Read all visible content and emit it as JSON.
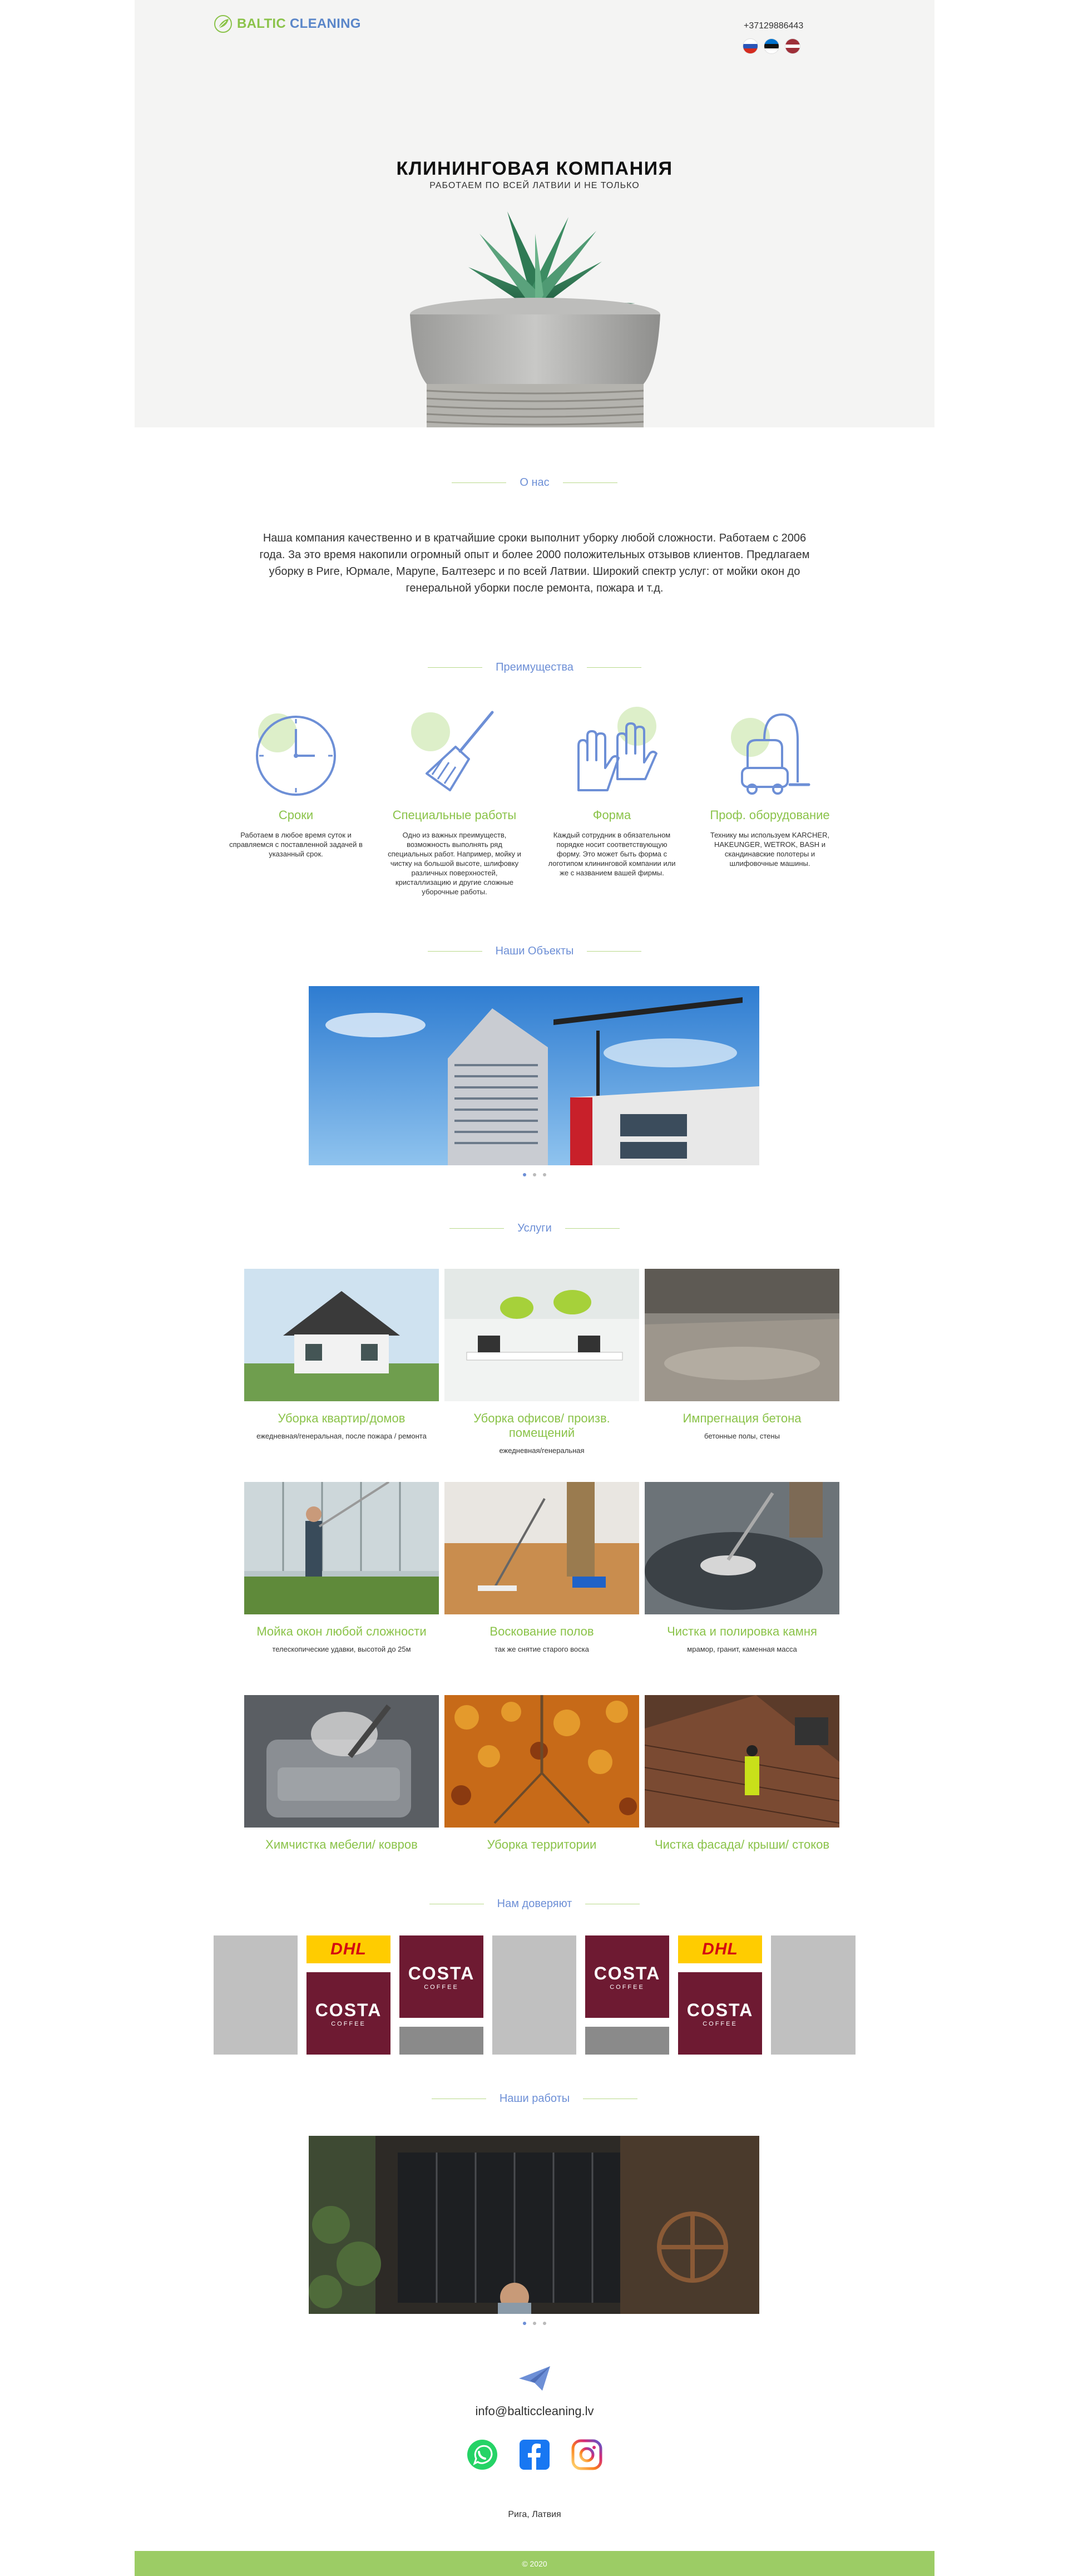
{
  "header": {
    "logo_part1": "BALTIC",
    "logo_part2": "CLEANING",
    "phone": "+37129886443",
    "languages": [
      "ru",
      "ee",
      "lv"
    ]
  },
  "hero": {
    "title": "КЛИНИНГОВАЯ КОМПАНИЯ",
    "subtitle": "РАБОТАЕМ ПО ВСЕЙ ЛАТВИИ И НЕ ТОЛЬКО"
  },
  "about": {
    "title": "О нас",
    "text": "Наша компания качественно и в кратчайшие сроки выполнит уборку любой сложности. Работаем с 2006 года. За это время накопили огромный опыт и более 2000 положительных отзывов клиентов. Предлагаем уборку в Риге, Юрмале, Марупе, Балтезерс и по всей Латвии. Широкий спектр услуг: от мойки окон до генеральной уборки после ремонта, пожара и т.д."
  },
  "advantages": {
    "title": "Преимущества",
    "items": [
      {
        "title": "Сроки",
        "text": "Работаем в любое время суток и справляемся с поставленной задачей в указанный срок.",
        "icon": "clock-icon"
      },
      {
        "title": "Специальные работы",
        "text": "Одно из важных преимуществ, возможность выполнять ряд специальных работ. Например, мойку и чистку на большой высоте, шлифовку различных поверхностей, кристаллизацию и другие сложные уборочные работы.",
        "icon": "broom-icon"
      },
      {
        "title": "Форма",
        "text": "Каждый сотрудник в обязательном порядке носит соответствующую форму. Это может быть форма с логотипом клининговой компании или же с названием вашей фирмы.",
        "icon": "gloves-icon"
      },
      {
        "title": "Проф. оборудование",
        "text": "Технику мы используем KARCHER, HAKEUNGER, WETROK, BASH и скандинавские полотеры и шлифовочные машины.",
        "icon": "vacuum-icon"
      }
    ]
  },
  "objects": {
    "title": "Наши Объекты"
  },
  "services": {
    "title": "Услуги",
    "items": [
      {
        "title": "Уборка квартир/домов",
        "text": "ежедневная/генеральная, после пожара / ремонта"
      },
      {
        "title": "Уборка офисов/ произв. помещений",
        "text": "ежедневная/генеральная"
      },
      {
        "title": "Импрегнация бетона",
        "text": "бетонные полы, стены"
      },
      {
        "title": "Мойка окон любой сложности",
        "text": "телескопические удавки, высотой до 25м"
      },
      {
        "title": "Воскование полов",
        "text": "так же снятие старого воска"
      },
      {
        "title": "Чистка и полировка камня",
        "text": "мрамор, гранит, каменная масса"
      },
      {
        "title": "Химчистка мебели/ ковров",
        "text": ""
      },
      {
        "title": "Уборка территории",
        "text": ""
      },
      {
        "title": "Чистка фасада/ крыши/ стоков",
        "text": ""
      }
    ]
  },
  "clients": {
    "title": "Нам доверяют",
    "dhl": "DHL",
    "costa": "COSTA",
    "costa_sub": "COFFEE"
  },
  "works": {
    "title": "Наши работы"
  },
  "contacts": {
    "email": "info@balticcleaning.lv",
    "city": "Рига, Латвия"
  },
  "footer": {
    "copyright": "© 2020"
  },
  "colors": {
    "accent_green": "#8bc34a",
    "accent_blue": "#6d8fd6",
    "footer_green": "#9ccc65"
  }
}
